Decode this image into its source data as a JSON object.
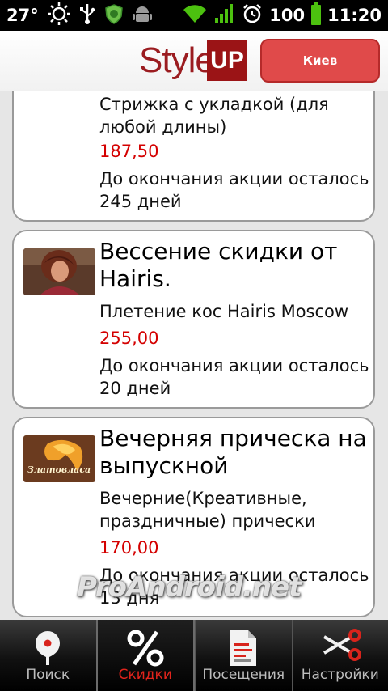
{
  "status_bar": {
    "temperature": "27°",
    "battery": "100",
    "time": "11:20",
    "icons": [
      "sun-icon",
      "usb-icon",
      "antivirus-icon",
      "android-debug-icon",
      "wifi-icon",
      "signal-icon",
      "alarm-icon",
      "battery-icon"
    ]
  },
  "header": {
    "logo_style": "Style",
    "logo_up": "UP",
    "city_button": "Киев",
    "brand_color": "#9b1416",
    "button_color": "#e04a4a"
  },
  "deals": [
    {
      "title": "",
      "description": "Стрижка с укладкой (для любой длины)",
      "price": "187,50",
      "remaining": "До окончания акции осталось 245 дней"
    },
    {
      "title": "Вессение скидки от Hairis.",
      "description": "Плетение кос Hairis Moscow",
      "price": "255,00",
      "remaining": "До окончания акции осталось 20 дней",
      "thumbnail": "woman-photo"
    },
    {
      "title": "Вечерняя прическа на выпускной",
      "description": "Вечерние(Креативные, праздничные) прически",
      "price": "170,00",
      "remaining": "До окончания акции осталось 13 дня",
      "thumbnail": "zlatovlasa-logo",
      "thumbnail_text": "Златовласа"
    }
  ],
  "watermark": "ProAndroid.net",
  "tabs": [
    {
      "label": "Поиск",
      "icon": "map-pin-icon",
      "active": false
    },
    {
      "label": "Скидки",
      "icon": "percent-icon",
      "active": true
    },
    {
      "label": "Посещения",
      "icon": "document-icon",
      "active": false
    },
    {
      "label": "Настройки",
      "icon": "scissors-icon",
      "active": false
    }
  ],
  "colors": {
    "price": "#d40000",
    "active_tab": "#e2241c"
  }
}
